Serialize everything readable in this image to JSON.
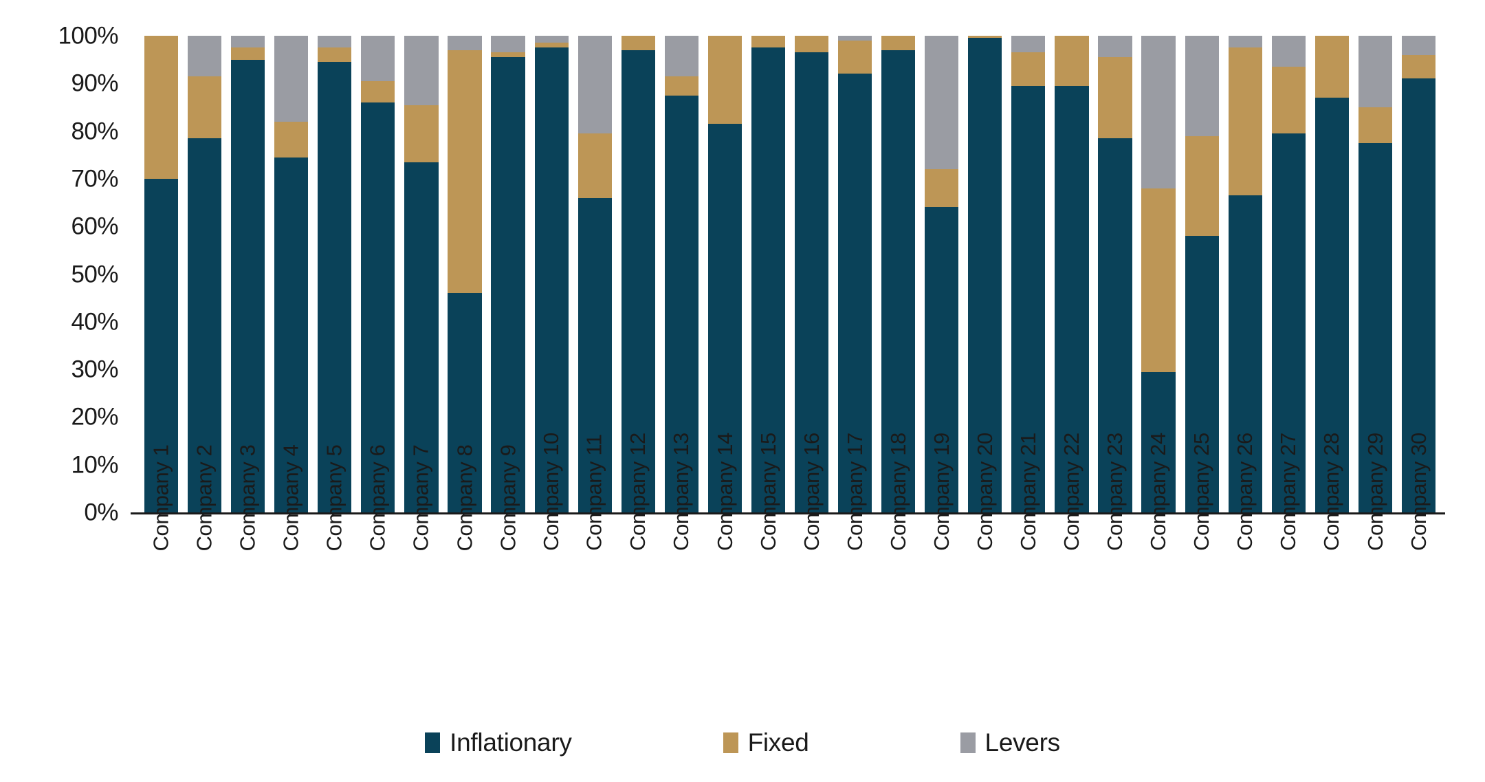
{
  "chart_data": {
    "type": "bar",
    "subtype": "stacked-bar-100-percent",
    "title": "",
    "subtitle": "",
    "xlabel": "",
    "ylabel": "",
    "ylim": [
      0,
      100
    ],
    "grid": false,
    "legend_position": "bottom-center",
    "y_tick_labels": [
      "100%",
      "90%",
      "80%",
      "70%",
      "60%",
      "50%",
      "40%",
      "30%",
      "20%",
      "10%",
      "0%"
    ],
    "y_tick_values": [
      100,
      90,
      80,
      70,
      60,
      50,
      40,
      30,
      20,
      10,
      0
    ],
    "categories": [
      "Company 1",
      "Company 2",
      "Company 3",
      "Company 4",
      "Company 5",
      "Company 6",
      "Company 7",
      "Company 8",
      "Company 9",
      "Company 10",
      "Company 11",
      "Company 12",
      "Company 13",
      "Company 14",
      "Company 15",
      "Company 16",
      "Company 17",
      "Company 18",
      "Company 19",
      "Company 20",
      "Company 21",
      "Company 22",
      "Company 23",
      "Company 24",
      "Company 25",
      "Company 26",
      "Company 27",
      "Company 28",
      "Company 29",
      "Company 30"
    ],
    "series": [
      {
        "name": "Inflationary",
        "color": "#0a4259",
        "values": [
          70.0,
          78.5,
          95.0,
          74.5,
          94.5,
          86.0,
          73.5,
          46.0,
          95.5,
          97.5,
          66.0,
          97.0,
          87.5,
          81.5,
          97.5,
          96.5,
          92.0,
          97.0,
          64.0,
          99.5,
          89.5,
          89.5,
          78.5,
          29.5,
          58.0,
          66.5,
          79.5,
          87.0,
          77.5,
          91.0
        ]
      },
      {
        "name": "Fixed",
        "color": "#bd9656",
        "values": [
          30.0,
          13.0,
          2.5,
          7.5,
          3.0,
          4.5,
          12.0,
          51.0,
          1.0,
          1.0,
          13.5,
          3.0,
          4.0,
          18.5,
          2.5,
          3.5,
          7.0,
          3.0,
          8.0,
          0.5,
          7.0,
          10.5,
          17.0,
          38.5,
          21.0,
          31.0,
          14.0,
          13.0,
          7.5,
          5.0
        ]
      },
      {
        "name": "Levers",
        "color": "#9a9ca3",
        "values": [
          0.0,
          8.5,
          2.5,
          18.0,
          2.5,
          9.5,
          14.5,
          3.0,
          3.5,
          1.5,
          20.5,
          0.0,
          8.5,
          0.0,
          0.0,
          0.0,
          1.0,
          0.0,
          28.0,
          0.0,
          3.5,
          0.0,
          4.5,
          32.0,
          21.0,
          2.5,
          6.5,
          0.0,
          15.0,
          4.0
        ]
      }
    ],
    "legend": [
      {
        "label": "Inflationary",
        "color": "#0a4259"
      },
      {
        "label": "Fixed",
        "color": "#bd9656"
      },
      {
        "label": "Levers",
        "color": "#9a9ca3"
      }
    ]
  },
  "colors": {
    "inflationary": "#0a4259",
    "fixed": "#bd9656",
    "levers": "#9a9ca3",
    "axis": "#1a1a1a",
    "background": "#ffffff"
  }
}
